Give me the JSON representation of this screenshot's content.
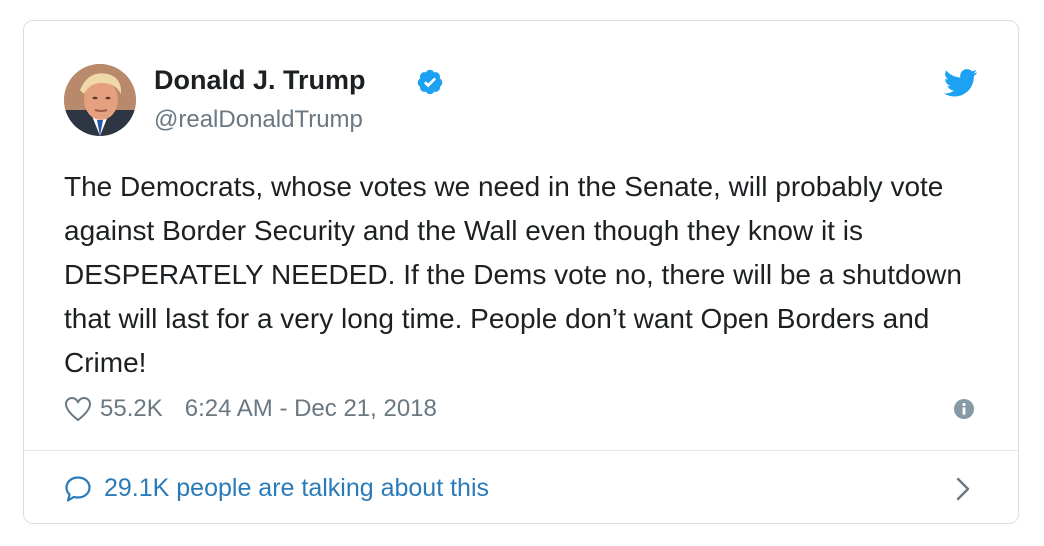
{
  "tweet": {
    "author": {
      "display_name": "Donald J. Trump",
      "handle": "@realDonaldTrump",
      "verified": true,
      "avatar_icon": "profile-photo"
    },
    "text": "The Democrats, whose votes we need in the Senate, will probably vote against Border Security and the Wall even though they know it is DESPERATELY NEEDED. If the Dems vote no, there will be a shutdown that will last for a very long time. People don’t want Open Borders and Crime!",
    "likes": "55.2K",
    "timestamp": "6:24 AM - Dec 21, 2018",
    "icons": {
      "brand": "twitter-bird-icon",
      "verified": "verified-badge-icon",
      "like": "heart-icon",
      "info": "info-icon",
      "conversation": "speech-bubble-icon",
      "more": "chevron-right-icon"
    }
  },
  "footer": {
    "talking_label": "29.1K people are talking about this"
  },
  "colors": {
    "text": "#1c2022",
    "secondary": "#697882",
    "link": "#2b7bb9",
    "twitter_blue": "#1da1f2",
    "border": "#d9dfe3"
  }
}
